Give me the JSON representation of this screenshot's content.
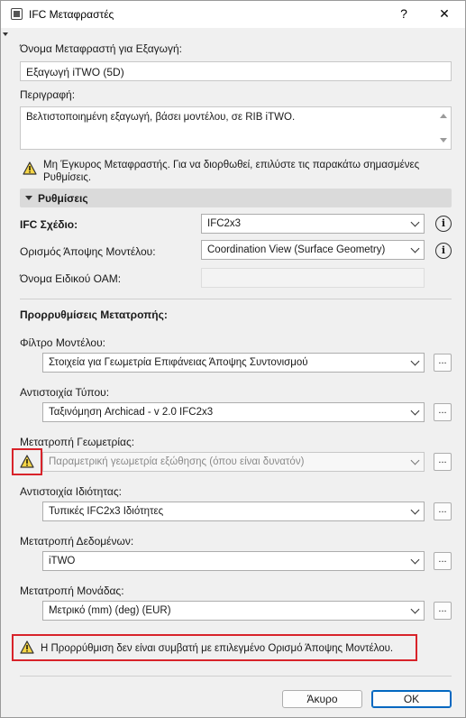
{
  "window": {
    "title": "IFC Μεταφραστές",
    "help_label": "?",
    "close_label": "✕"
  },
  "translator_name": {
    "label": "Όνομα Μεταφραστή για Εξαγωγή:",
    "value": "Εξαγωγή iTWO (5D)"
  },
  "description": {
    "label": "Περιγραφή:",
    "value": "Βελτιστοποιημένη εξαγωγή, βάσει μοντέλου, σε RIB iTWO."
  },
  "invalid_warning": {
    "line1": "Μη Έγκυρος Μεταφραστής. Για να διορθωθεί, επιλύστε τις παρακάτω σημασμένες",
    "line2": "Ρυθμίσεις."
  },
  "settings_section": {
    "label": "Ρυθμίσεις"
  },
  "ifc_schema": {
    "label": "IFC Σχέδιο:",
    "value": "IFC2x3"
  },
  "model_view": {
    "label": "Ορισμός Άποψης Μοντέλου:",
    "value": "Coordination View (Surface Geometry)"
  },
  "special_oam": {
    "label": "Όνομα Ειδικού ΟΑΜ:"
  },
  "presets": {
    "heading": "Προρρυθμίσεις Μετατροπής:",
    "ellipsis": "...",
    "model_filter": {
      "label": "Φίλτρο Μοντέλου:",
      "value": "Στοιχεία για Γεωμετρία Επιφάνειας Άποψης Συντονισμού"
    },
    "type_mapping": {
      "label": "Αντιστοιχία Τύπου:",
      "value": "Ταξινόμηση Archicad - v 2.0 IFC2x3"
    },
    "geometry_conversion": {
      "label": "Μετατροπή Γεωμετρίας:",
      "value": "Παραμετρική γεωμετρία εξώθησης (όπου είναι δυνατόν)"
    },
    "property_mapping": {
      "label": "Αντιστοιχία Ιδιότητας:",
      "value": "Τυπικές IFC2x3 Ιδιότητες"
    },
    "data_conversion": {
      "label": "Μετατροπή Δεδομένων:",
      "value": "iTWO"
    },
    "unit_conversion": {
      "label": "Μετατροπή Μονάδας:",
      "value": "Μετρικό (mm) (deg) (EUR)"
    }
  },
  "incompatible_warning": {
    "text": "Η Προρρύθμιση δεν είναι συμβατή με επιλεγμένο Ορισμό Άποψης Μοντέλου."
  },
  "footer": {
    "cancel_label": "Άκυρο",
    "ok_label": "OK"
  },
  "colors": {
    "warning_fill": "#f5d547",
    "highlight_red": "#d8232a",
    "ok_border": "#0067c0"
  }
}
